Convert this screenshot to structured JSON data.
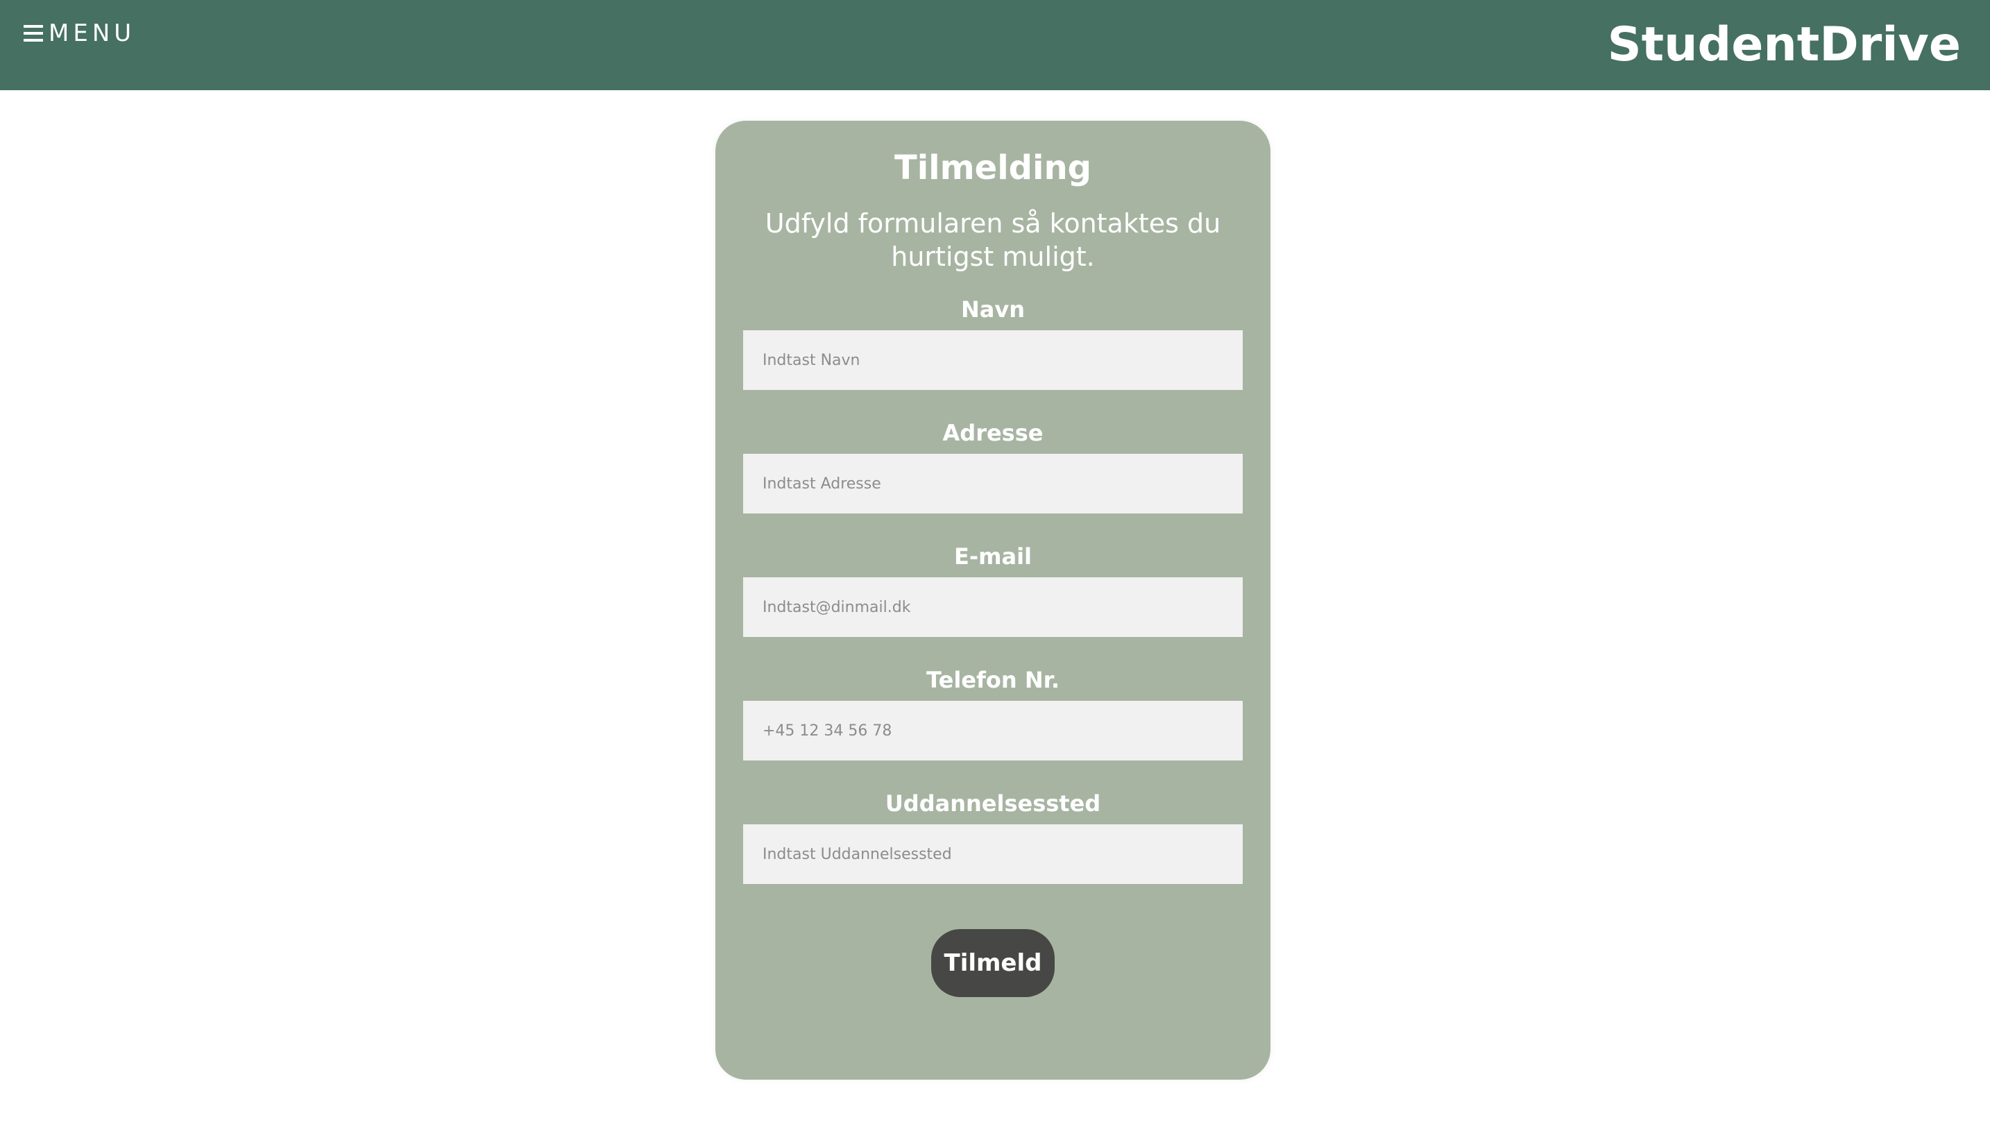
{
  "header": {
    "menu_label": "MENU",
    "menu_icon": "hamburger-icon",
    "brand": "StudentDrive",
    "background_color": "#457062"
  },
  "form": {
    "title": "Tilmelding",
    "subtitle": "Udfyld formularen så kontaktes du hurtigst muligt.",
    "card_color": "#a7b4a2",
    "fields": [
      {
        "label": "Navn",
        "placeholder": "Indtast Navn",
        "value": ""
      },
      {
        "label": "Adresse",
        "placeholder": "Indtast Adresse",
        "value": ""
      },
      {
        "label": "E-mail",
        "placeholder": "Indtast@dinmail.dk",
        "value": ""
      },
      {
        "label": "Telefon Nr.",
        "placeholder": "+45 12 34 56 78",
        "value": ""
      },
      {
        "label": "Uddannelsessted",
        "placeholder": "Indtast Uddannelsessted",
        "value": ""
      }
    ],
    "submit_label": "Tilmeld",
    "submit_color": "#474845"
  }
}
